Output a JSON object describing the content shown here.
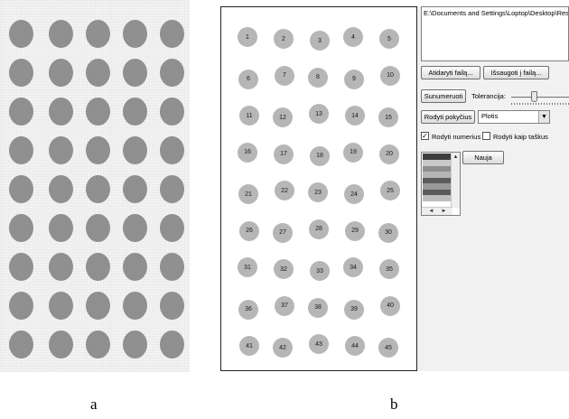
{
  "captions": {
    "left": "a",
    "right": "b"
  },
  "dots": [
    "1",
    "2",
    "3",
    "4",
    "5",
    "6",
    "7",
    "8",
    "9",
    "10",
    "11",
    "12",
    "13",
    "14",
    "15",
    "16",
    "17",
    "18",
    "19",
    "20",
    "21",
    "22",
    "23",
    "24",
    "25",
    "26",
    "27",
    "28",
    "29",
    "30",
    "31",
    "32",
    "33",
    "34",
    "35",
    "36",
    "37",
    "38",
    "39",
    "40",
    "41",
    "42",
    "43",
    "44",
    "45"
  ],
  "path_text": "E:\\Documents and Settings\\Loptop\\Desktop\\Result",
  "buttons": {
    "open_file": "Atidaryti failą...",
    "save_file": "Išsaugoti į failą...",
    "number": "Sunumeruoti",
    "show_changes": "Rodyti pokyčius",
    "new": "Nauja"
  },
  "tolerance": {
    "label": "Tolerancija:",
    "level": 0.38
  },
  "select": {
    "value": "Plotis"
  },
  "checkboxes": {
    "show_numbers": {
      "label": "Rodyti numerius",
      "checked": true
    },
    "show_as_points": {
      "label": "Rodyti kaip taškus",
      "checked": false
    }
  },
  "palette": [
    "#3e3e3e",
    "#c9c9c9",
    "#8e8e8e",
    "#b5b5b5",
    "#5c5c5c",
    "#999999",
    "#5a5a5a",
    "#bdbdbd"
  ],
  "colors": {
    "dot": "#b6b6b6",
    "photo_dot": "#9d9d9d"
  }
}
